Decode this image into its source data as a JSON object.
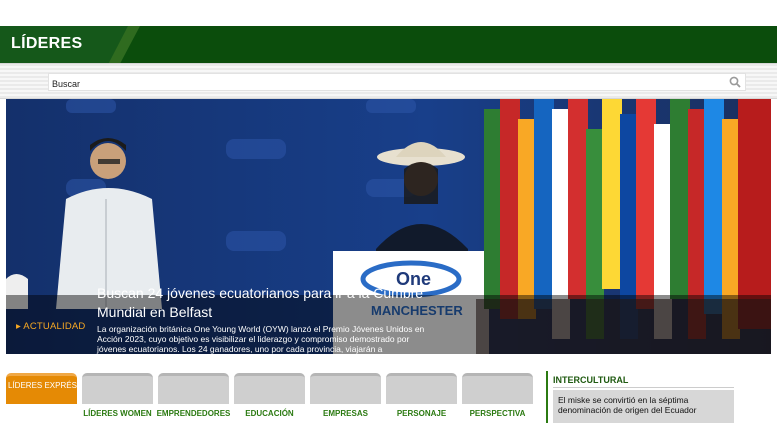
{
  "header": {
    "logo": "LÍDERES"
  },
  "search": {
    "placeholder": "Buscar"
  },
  "hero": {
    "title": "Buscan 24 jóvenes ecuatorianos para ir a la Cumbre Mundial en Belfast",
    "body": "La organización británica One Young World (OYW) lanzó el Premio Jóvenes Unidos en Acción 2023, cuyo objetivo es visibilizar el liderazgo y compromiso demostrado por jóvenes ecuatorianos. Los 24 ganadores, uno por cada provincia, viajarán a",
    "category": "ACTUALIDAD",
    "podium_text": "One",
    "podium_sub": "MANCHESTER"
  },
  "tabs": [
    {
      "label": "LÍDERES EXPRÉS",
      "active": true
    },
    {
      "label": "LÍDERES WOMEN"
    },
    {
      "label": "EMPRENDEDORES"
    },
    {
      "label": "EDUCACIÓN"
    },
    {
      "label": "EMPRESAS"
    },
    {
      "label": "PERSONAJE"
    },
    {
      "label": "PERSPECTIVA"
    }
  ],
  "side": {
    "title": "INTERCULTURAL",
    "headline": "El miske se convirtió en la séptima denominación de origen del Ecuador"
  },
  "colors": {
    "header_green": "#0b4d0c",
    "accent_orange": "#e58a05",
    "tab_label_green": "#2b7a11"
  }
}
